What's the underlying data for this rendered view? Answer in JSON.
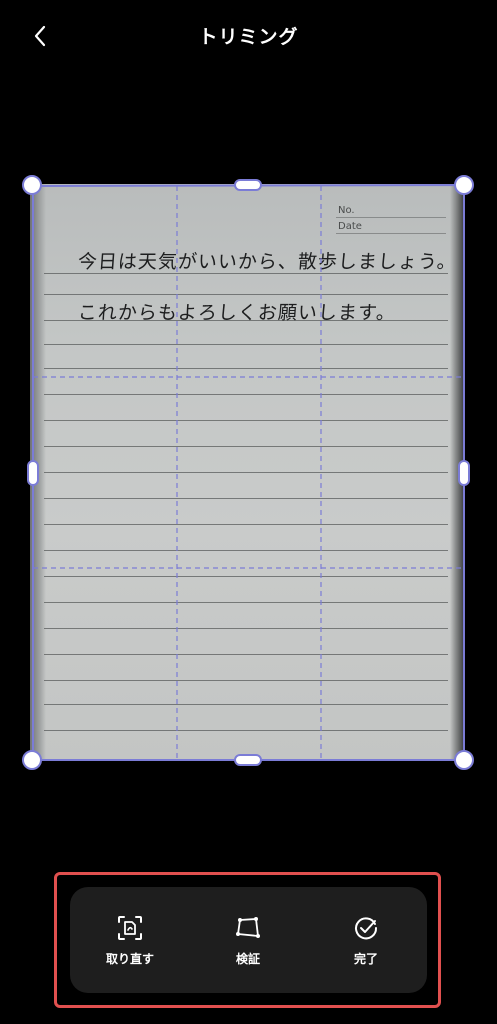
{
  "header": {
    "title": "トリミング",
    "back_icon": "chevron-left-icon"
  },
  "notebook": {
    "no_label": "No.",
    "date_label": "Date",
    "line1": "今日は天気がいいから、散歩しましょう。",
    "line2": "これからもよろしくお願いします。"
  },
  "toolbar": {
    "retake_label": "取り直す",
    "retake_icon": "retake-document-icon",
    "verify_label": "検証",
    "verify_icon": "quadrilateral-icon",
    "done_label": "完了",
    "done_icon": "check-circle-icon"
  },
  "colors": {
    "crop_frame": "#7b7cd6",
    "highlight": "#e0504f",
    "toolbar_bg": "#1e1e1e"
  }
}
